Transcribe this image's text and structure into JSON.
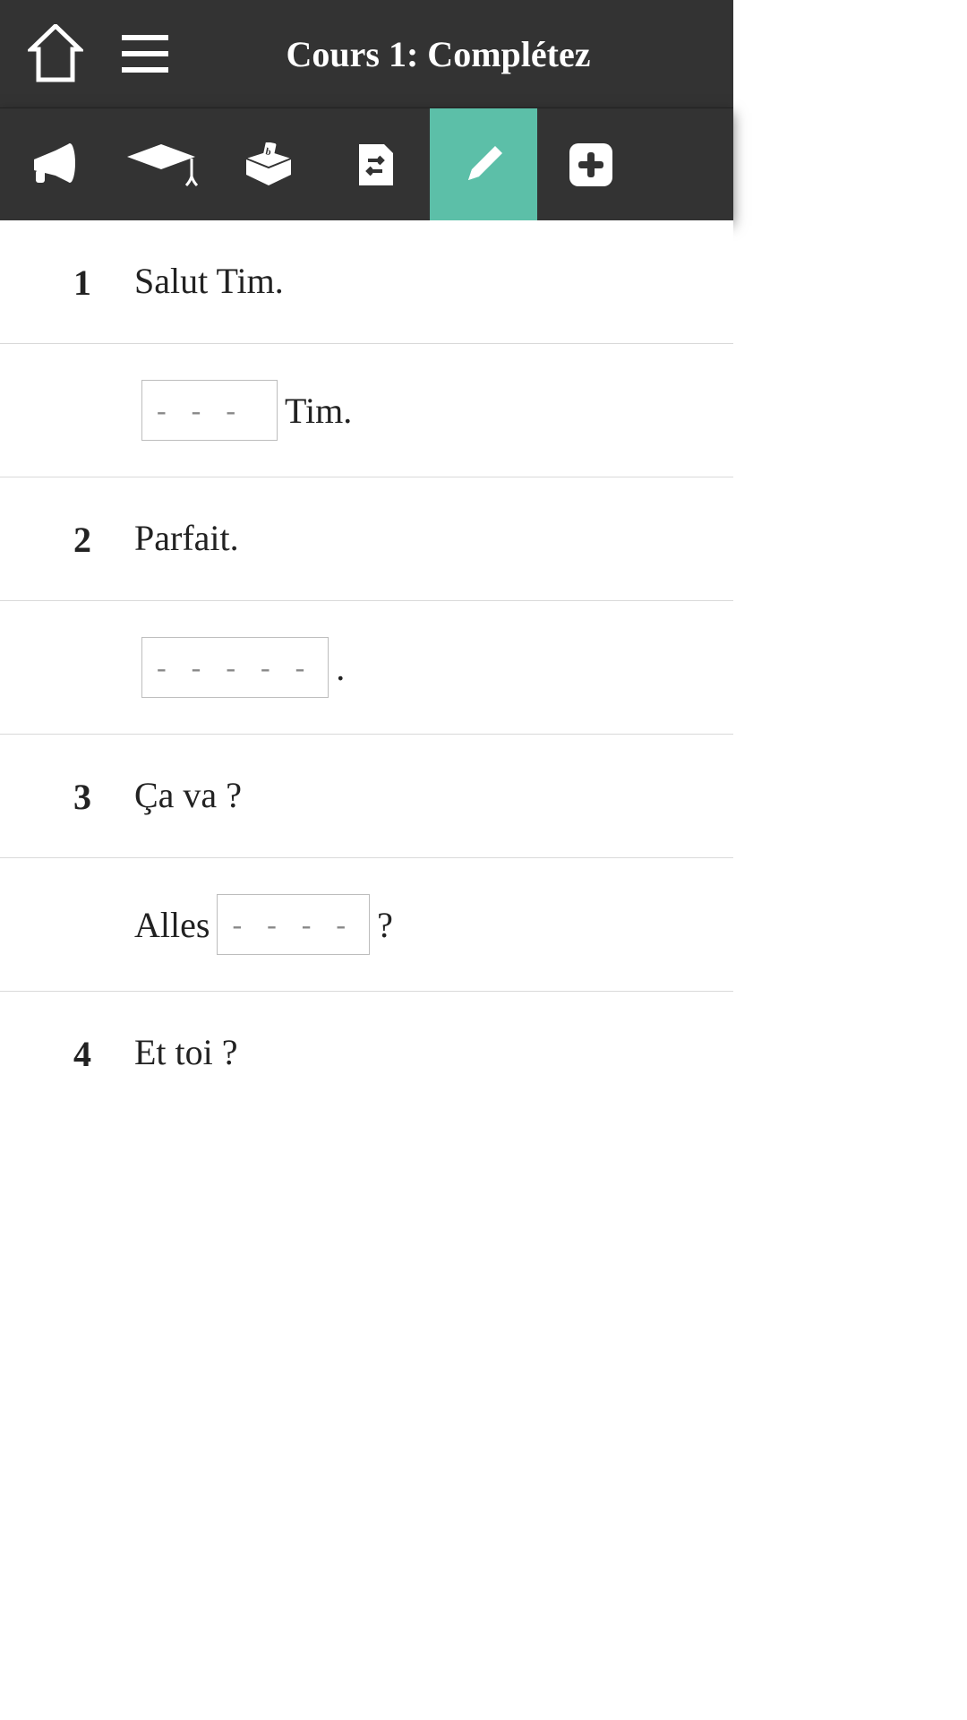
{
  "header": {
    "title": "Cours 1: Complétez"
  },
  "tabs": {
    "active_index": 4,
    "icons": [
      "megaphone-icon",
      "graduation-cap-icon",
      "deposit-box-icon",
      "swap-page-icon",
      "pencil-icon",
      "plus-icon"
    ]
  },
  "items": [
    {
      "num": "1",
      "prompt": "Salut Tim.",
      "answer_prefix": "",
      "answer_placeholder": "- - -",
      "answer_width": 152,
      "answer_suffix": " Tim."
    },
    {
      "num": "2",
      "prompt": "Parfait.",
      "answer_prefix": "",
      "answer_placeholder": "- - - - -",
      "answer_width": 188,
      "answer_suffix": "."
    },
    {
      "num": "3",
      "prompt": "Ça va ?",
      "answer_prefix": "Alles ",
      "answer_placeholder": "- - - -",
      "answer_width": 170,
      "answer_suffix": "?"
    },
    {
      "num": "4",
      "prompt": "Et toi ?",
      "answer_prefix": "",
      "answer_placeholder": "",
      "answer_width": 0,
      "answer_suffix": ""
    }
  ]
}
